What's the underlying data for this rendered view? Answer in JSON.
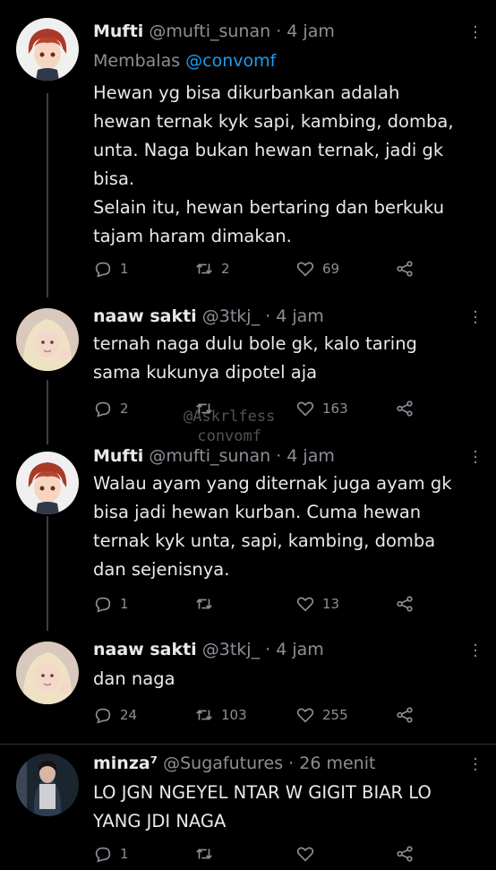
{
  "tweets": [
    {
      "name": "Mufti",
      "handle": "@mufti_sunan",
      "time": "· 4 jam",
      "reply_label": "Membalas",
      "reply_to": "@convomf",
      "text": "Hewan yg bisa dikurbankan adalah\nhewan ternak kyk sapi, kambing, domba,\nunta. Naga bukan hewan ternak, jadi gk\nbisa.\nSelain itu, hewan bertaring dan berkuku\ntajam haram dimakan.",
      "replies": "1",
      "retweets": "2",
      "likes": "69",
      "avatar": "anime-boy-avatar"
    },
    {
      "name": "naaw sakti",
      "handle": "@3tkj_",
      "time": "· 4 jam",
      "text": "ternah naga dulu bole gk, kalo taring\nsama kukunya dipotel aja",
      "replies": "2",
      "retweets": "",
      "likes": "163",
      "avatar": "girl-photo-avatar"
    },
    {
      "name": "Mufti",
      "handle": "@mufti_sunan",
      "time": "· 4 jam",
      "text": "Walau ayam yang diternak juga ayam gk\nbisa jadi hewan kurban. Cuma hewan\nternak kyk unta, sapi, kambing, domba\ndan sejenisnya.",
      "replies": "1",
      "retweets": "",
      "likes": "13",
      "avatar": "anime-boy-avatar"
    },
    {
      "name": "naaw sakti",
      "handle": "@3tkj_",
      "time": "· 4 jam",
      "text": "dan naga",
      "replies": "24",
      "retweets": "103",
      "likes": "255",
      "avatar": "girl-photo-avatar"
    },
    {
      "name": "minza⁷",
      "handle": "@Sugafutures",
      "time": "· 26 menit",
      "text": "LO JGN NGEYEL NTAR W GIGIT BIAR LO\nYANG JDI NAGA",
      "replies": "1",
      "retweets": "",
      "likes": "",
      "avatar": "person-photo-avatar"
    }
  ],
  "watermark": {
    "line1": "@Askrlfess",
    "line2": "convomf"
  },
  "colors": {
    "background": "#000000",
    "text": "#e7e9ea",
    "secondary": "#8b9096",
    "link": "#1d9bf0"
  }
}
